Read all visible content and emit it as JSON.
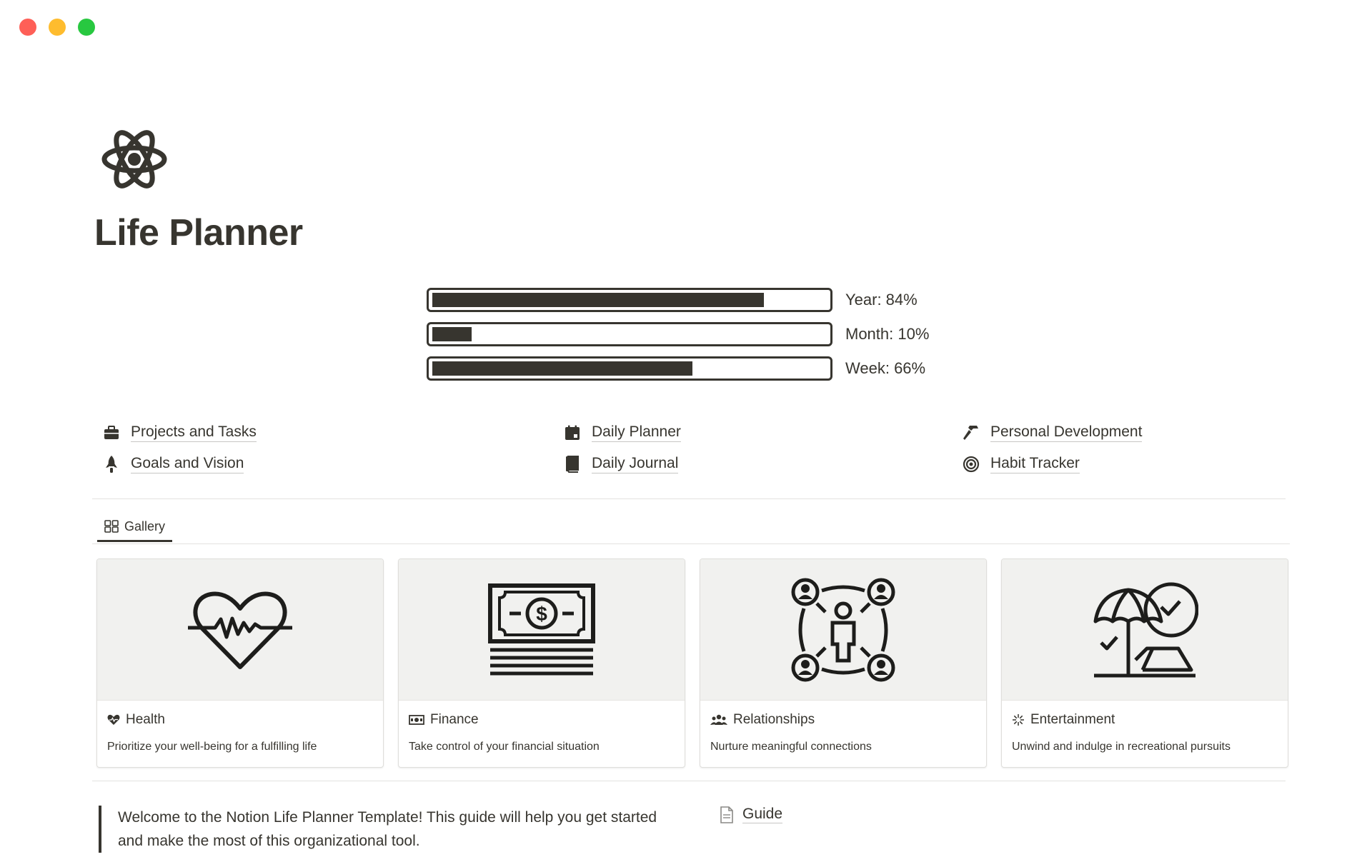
{
  "page": {
    "title": "Life Planner",
    "icon": "atom-icon"
  },
  "progress": [
    {
      "label": "Year: 84%",
      "fraction": 0.84
    },
    {
      "label": "Month: 10%",
      "fraction": 0.1
    },
    {
      "label": "Week: 66%",
      "fraction": 0.66
    }
  ],
  "links": [
    {
      "label": "Projects and Tasks",
      "icon": "briefcase-icon"
    },
    {
      "label": "Goals and Vision",
      "icon": "rocket-icon"
    },
    {
      "label": "Daily Planner",
      "icon": "calendar-icon"
    },
    {
      "label": "Daily Journal",
      "icon": "book-icon"
    },
    {
      "label": "Personal Development",
      "icon": "hammer-icon"
    },
    {
      "label": "Habit Tracker",
      "icon": "target-icon"
    }
  ],
  "gallery": {
    "tab_label": "Gallery",
    "tab_icon": "gallery-grid-icon",
    "cards": [
      {
        "title": "Health",
        "description": "Prioritize your well-being for a fulfilling life",
        "icon": "heart-pulse-icon",
        "cover": "heartbeat-cover"
      },
      {
        "title": "Finance",
        "description": "Take control of your financial situation",
        "icon": "money-icon",
        "cover": "banknote-cover"
      },
      {
        "title": "Relationships",
        "description": "Nurture meaningful connections",
        "icon": "people-icon",
        "cover": "network-cover"
      },
      {
        "title": "Entertainment",
        "description": "Unwind and indulge in recreational pursuits",
        "icon": "sparkle-icon",
        "cover": "beach-cover"
      }
    ]
  },
  "quote": {
    "text": "Welcome to the Notion Life Planner Template! This guide will help you get started and make the most of this organizational tool."
  },
  "guide": {
    "label": "Guide",
    "icon": "document-icon"
  },
  "colors": {
    "text": "#37352f",
    "cover_bg": "#f1f1ef",
    "close": "#fe5f57",
    "minimize": "#febc2e",
    "maximize": "#28c840"
  }
}
